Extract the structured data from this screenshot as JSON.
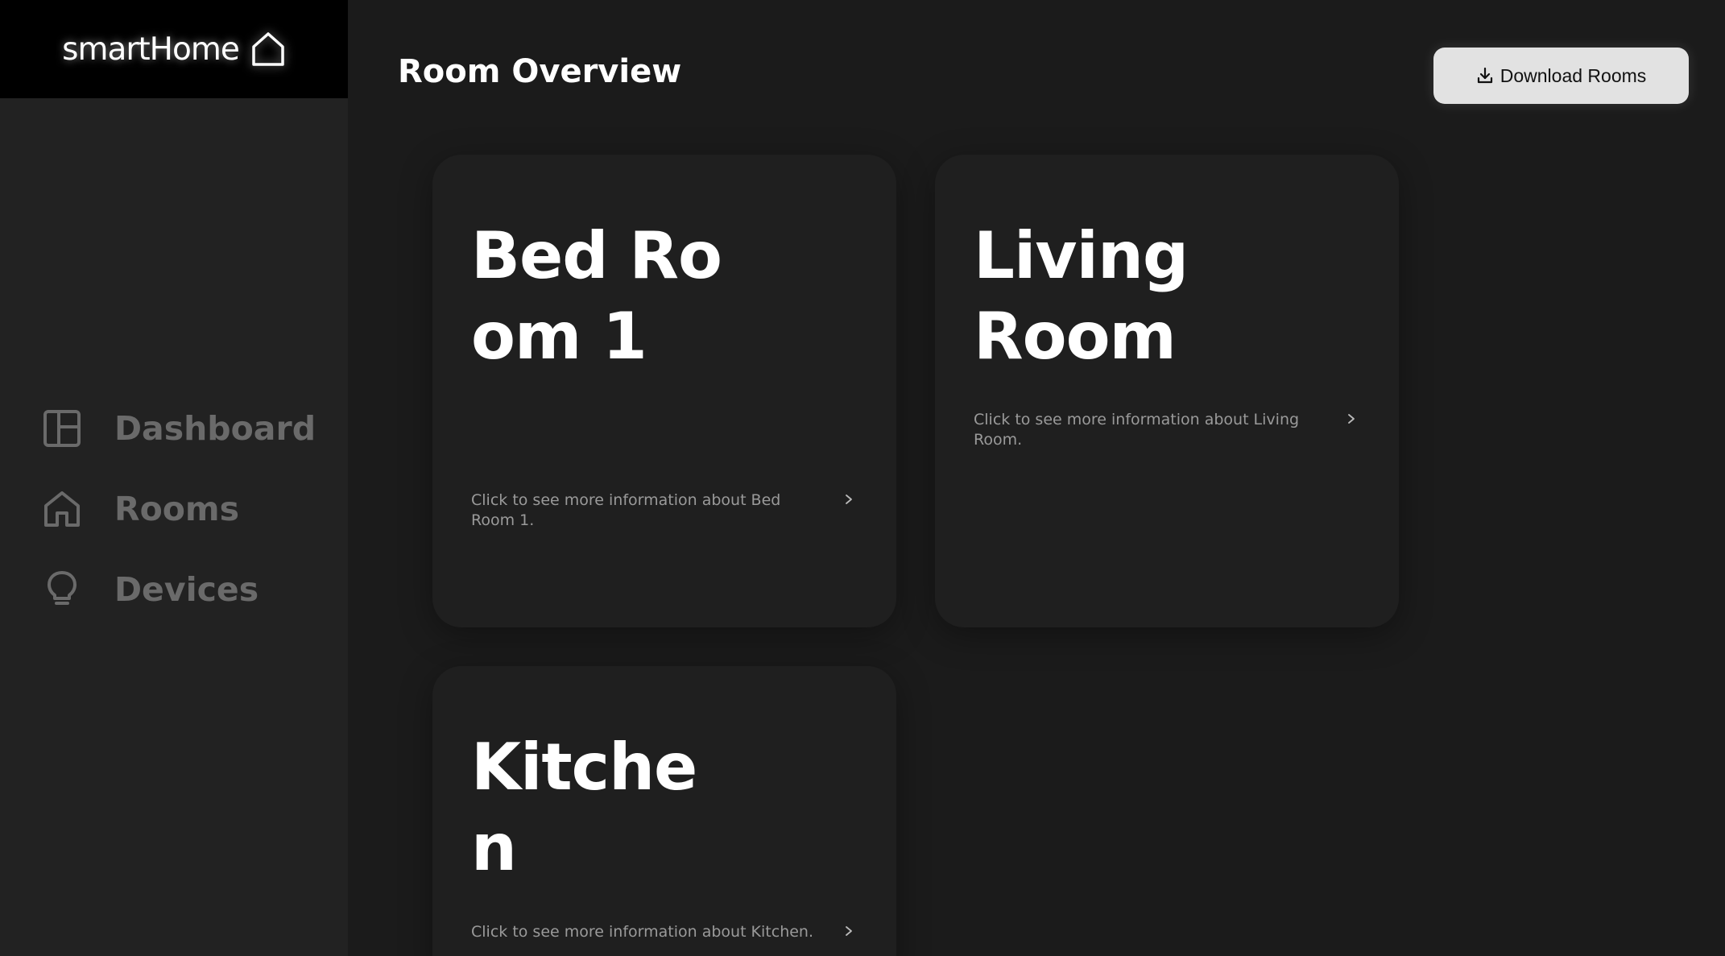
{
  "brand": {
    "name": "smartHome",
    "icon": "home-outline-icon"
  },
  "sidebar": {
    "items": [
      {
        "label": "Dashboard",
        "icon": "dashboard-layout-icon"
      },
      {
        "label": "Rooms",
        "icon": "home-icon"
      },
      {
        "label": "Devices",
        "icon": "lightbulb-icon"
      }
    ]
  },
  "header": {
    "title": "Room Overview",
    "download_label": "Download Rooms",
    "download_icon": "download-icon"
  },
  "rooms": [
    {
      "name": "Bed Room 1",
      "link_text": "Click to see more information about Bed Room 1."
    },
    {
      "name": "Living Room",
      "link_text": "Click to see more information about Living Room."
    },
    {
      "name": "Kitchen",
      "link_text": "Click to see more information about Kitchen."
    }
  ],
  "colors": {
    "background": "#1b1b1b",
    "sidebar": "#222222",
    "card": "#1f1f1f",
    "nav_text": "#6a6a6a",
    "button": "#e2e2e2"
  }
}
